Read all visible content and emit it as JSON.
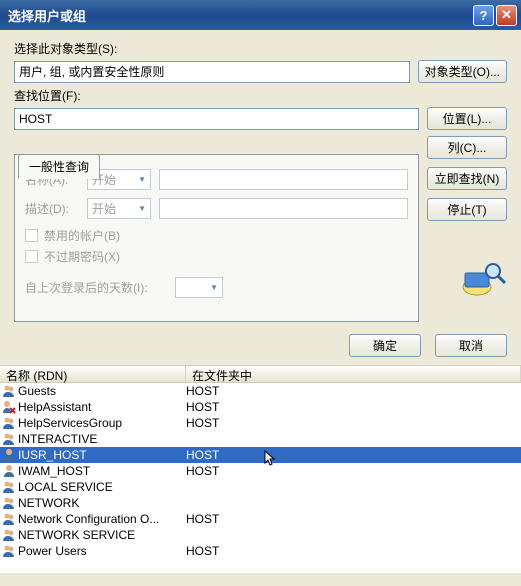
{
  "title": "选择用户或组",
  "section": {
    "objtype_label": "选择此对象类型(S):",
    "objtype_value": "用户, 组, 或内置安全性原则",
    "objtype_btn": "对象类型(O)...",
    "loc_label": "查找位置(F):",
    "loc_value": "HOST",
    "loc_btn": "位置(L)..."
  },
  "tab": {
    "label": "一般性查询",
    "name_lbl": "名称(A):",
    "name_sel": "开始",
    "desc_lbl": "描述(D):",
    "desc_sel": "开始",
    "cb_disabled": "禁用的帐户(B)",
    "cb_pwd": "不过期密码(X)",
    "days_lbl": "自上次登录后的天数(I):"
  },
  "side": {
    "columns": "列(C)...",
    "findnow": "立即查找(N)",
    "stop": "停止(T)"
  },
  "ok": "确定",
  "cancel": "取消",
  "listcols": {
    "name": "名称 (RDN)",
    "folder": "在文件夹中"
  },
  "rows": [
    {
      "n": "Guests",
      "f": "HOST",
      "t": "group"
    },
    {
      "n": "HelpAssistant",
      "f": "HOST",
      "t": "userx"
    },
    {
      "n": "HelpServicesGroup",
      "f": "HOST",
      "t": "group"
    },
    {
      "n": "INTERACTIVE",
      "f": "",
      "t": "group"
    },
    {
      "n": "IUSR_HOST",
      "f": "HOST",
      "t": "user",
      "sel": true
    },
    {
      "n": "IWAM_HOST",
      "f": "HOST",
      "t": "user"
    },
    {
      "n": "LOCAL SERVICE",
      "f": "",
      "t": "group"
    },
    {
      "n": "NETWORK",
      "f": "",
      "t": "group"
    },
    {
      "n": "Network Configuration O...",
      "f": "HOST",
      "t": "group"
    },
    {
      "n": "NETWORK SERVICE",
      "f": "",
      "t": "group"
    },
    {
      "n": "Power Users",
      "f": "HOST",
      "t": "group"
    }
  ]
}
